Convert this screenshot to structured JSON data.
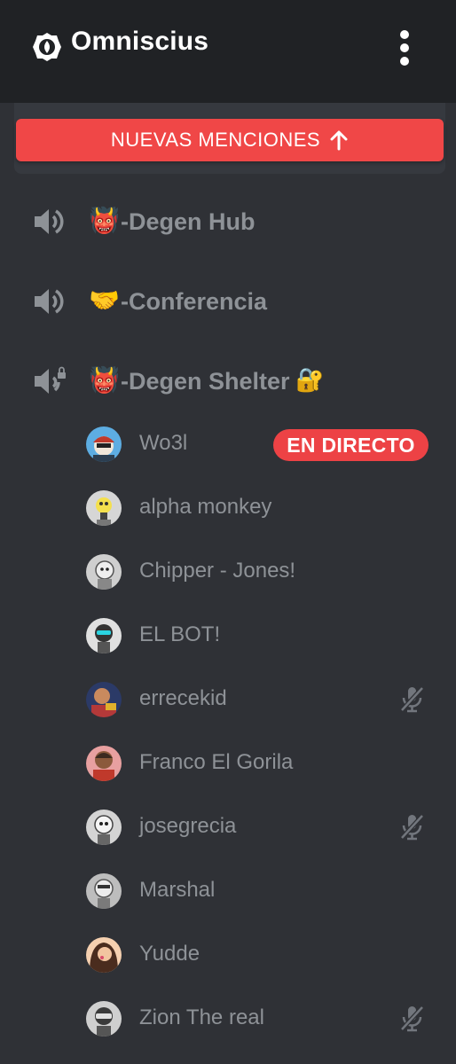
{
  "header": {
    "server_name": "Omniscius",
    "icons": {
      "server": "server-badge-icon",
      "menu": "more-vertical-icon"
    }
  },
  "mentions_banner": {
    "label": "NUEVAS MENCIONES",
    "icon": "arrow-up-icon",
    "color": "#f04747"
  },
  "channels": [
    {
      "emoji": "👹",
      "name": "-Degen Hub",
      "icon": "speaker-icon"
    },
    {
      "emoji": "🤝",
      "name": "-Conferencia",
      "icon": "speaker-icon"
    },
    {
      "emoji": "👹",
      "name": "-Degen Shelter",
      "suffix_emoji": "🔐",
      "icon": "speaker-lock-icon"
    }
  ],
  "members": [
    {
      "name": "Wo3l",
      "badge": "EN DIRECTO",
      "muted": false
    },
    {
      "name": "alpha monkey",
      "muted": false
    },
    {
      "name": "Chipper - Jones!",
      "muted": false
    },
    {
      "name": "EL BOT!",
      "muted": false
    },
    {
      "name": "errecekid",
      "muted": true
    },
    {
      "name": "Franco El Gorila",
      "muted": false
    },
    {
      "name": "josegrecia",
      "muted": true
    },
    {
      "name": "Marshal",
      "muted": false
    },
    {
      "name": "Yudde",
      "muted": false
    },
    {
      "name": "Zion The real",
      "muted": true
    }
  ],
  "colors": {
    "background": "#2f3136",
    "header": "#202225",
    "live": "#ed4245",
    "text_muted": "#8e9297"
  }
}
